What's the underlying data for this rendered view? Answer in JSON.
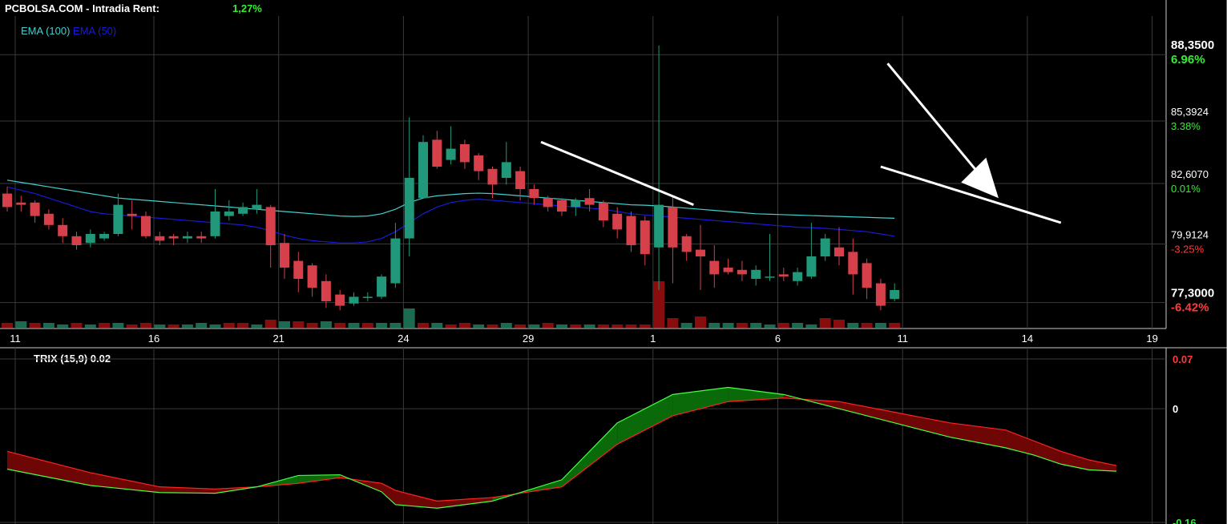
{
  "header": {
    "brand": "PCBOLSA.COM",
    "separator": "-",
    "mode": "Intradia",
    "rent_label": "Rent:",
    "rent_value": "1,27%"
  },
  "legend": [
    {
      "label": "EMA (100)",
      "color": "#3fd0d0"
    },
    {
      "label": "EMA (50)",
      "color": "#1a1ad8"
    }
  ],
  "colors": {
    "up": "#22987a",
    "down": "#d6404a",
    "vol_up": "#1a6b52",
    "vol_down": "#8a0d0d",
    "grid": "#3a3a3a",
    "positive_text": "#33ee33",
    "negative_text": "#ff3a3a",
    "trendline": "#ffffff"
  },
  "chart_data": [
    {
      "type": "candlestick",
      "title": "",
      "y_scale": {
        "min": 76.5,
        "max": 89.0
      },
      "price_labels": [
        {
          "price": "88,3500",
          "pct": "6.96%",
          "bold": true,
          "value": 88.35
        },
        {
          "price": "85,3924",
          "pct": "3.38%",
          "bold": false,
          "value": 85.3924
        },
        {
          "price": "82,6070",
          "pct": "0.01%",
          "bold": false,
          "value": 82.607
        },
        {
          "price": "79,9124",
          "pct": "-3.25%",
          "bold": false,
          "value": 79.9124
        },
        {
          "price": "77,3000",
          "pct": "-6.42%",
          "bold": true,
          "value": 77.3
        }
      ],
      "x_tick_labels": [
        {
          "label": "11",
          "index": 0
        },
        {
          "label": "16",
          "index": 10
        },
        {
          "label": "21",
          "index": 19
        },
        {
          "label": "24",
          "index": 28
        },
        {
          "label": "29",
          "index": 37
        },
        {
          "label": "1",
          "index": 46
        },
        {
          "label": "6",
          "index": 55
        },
        {
          "label": "11",
          "index": 64
        },
        {
          "label": "14",
          "index": 73
        },
        {
          "label": "19",
          "index": 82
        }
      ],
      "candles": [
        [
          81.8,
          81.2,
          82.1,
          81.0
        ],
        [
          81.4,
          81.3,
          81.7,
          81.0
        ],
        [
          81.4,
          80.8,
          81.5,
          80.5
        ],
        [
          80.9,
          80.4,
          81.1,
          80.2
        ],
        [
          80.4,
          79.9,
          80.7,
          79.6
        ],
        [
          79.9,
          79.5,
          80.1,
          79.3
        ],
        [
          79.6,
          80.0,
          80.2,
          79.4
        ],
        [
          79.8,
          80.0,
          80.1,
          79.7
        ],
        [
          80.0,
          81.3,
          81.8,
          79.9
        ],
        [
          80.9,
          80.8,
          81.5,
          80.2
        ],
        [
          80.8,
          79.9,
          81.0,
          79.8
        ],
        [
          79.9,
          79.7,
          80.1,
          79.5
        ],
        [
          79.9,
          79.8,
          80.0,
          79.5
        ],
        [
          79.8,
          79.9,
          80.1,
          79.6
        ],
        [
          79.9,
          79.8,
          80.1,
          79.6
        ],
        [
          79.9,
          81.0,
          82.0,
          79.8
        ],
        [
          80.8,
          81.0,
          81.5,
          80.6
        ],
        [
          80.9,
          81.2,
          81.4,
          80.8
        ],
        [
          81.1,
          81.3,
          82.0,
          80.9
        ],
        [
          81.2,
          79.5,
          81.3,
          78.5
        ],
        [
          79.6,
          78.5,
          80.0,
          78.0
        ],
        [
          78.8,
          78.0,
          79.2,
          77.4
        ],
        [
          78.6,
          77.6,
          78.7,
          77.2
        ],
        [
          77.9,
          77.0,
          78.2,
          76.7
        ],
        [
          77.3,
          76.8,
          77.5,
          76.6
        ],
        [
          76.9,
          77.2,
          77.4,
          76.8
        ],
        [
          77.2,
          77.2,
          77.4,
          77.0
        ],
        [
          77.2,
          78.1,
          78.2,
          77.1
        ],
        [
          77.8,
          79.8,
          80.5,
          77.6
        ],
        [
          79.8,
          82.5,
          85.2,
          79.0
        ],
        [
          81.6,
          84.1,
          84.4,
          81.6
        ],
        [
          84.2,
          83.0,
          84.6,
          82.9
        ],
        [
          83.3,
          83.8,
          84.8,
          83.1
        ],
        [
          84.0,
          83.2,
          84.2,
          82.9
        ],
        [
          83.5,
          82.8,
          83.6,
          82.4
        ],
        [
          82.9,
          82.2,
          83.0,
          81.6
        ],
        [
          82.5,
          83.2,
          84.1,
          82.2
        ],
        [
          82.8,
          82.0,
          83.0,
          81.5
        ],
        [
          82.0,
          81.6,
          82.2,
          81.3
        ],
        [
          81.6,
          81.2,
          81.7,
          81.0
        ],
        [
          81.5,
          81.0,
          81.6,
          80.8
        ],
        [
          81.2,
          81.5,
          81.6,
          80.8
        ],
        [
          81.6,
          81.3,
          82.0,
          81.0
        ],
        [
          81.4,
          80.6,
          81.5,
          80.3
        ],
        [
          80.9,
          80.2,
          81.2,
          79.8
        ],
        [
          80.8,
          79.5,
          81.0,
          79.2
        ],
        [
          80.6,
          79.1,
          80.8,
          78.6
        ],
        [
          79.4,
          81.3,
          88.4,
          77.5
        ],
        [
          81.2,
          79.4,
          81.7,
          77.8
        ],
        [
          79.9,
          79.2,
          80.0,
          78.8
        ],
        [
          79.3,
          79.0,
          80.4,
          77.5
        ],
        [
          78.8,
          78.2,
          79.5,
          77.6
        ],
        [
          78.5,
          78.3,
          78.9,
          78.2
        ],
        [
          78.4,
          78.2,
          78.8,
          77.9
        ],
        [
          78.0,
          78.4,
          78.6,
          77.7
        ],
        [
          78.1,
          78.1,
          80.0,
          77.9
        ],
        [
          78.2,
          78.1,
          78.5,
          77.9
        ],
        [
          77.9,
          78.3,
          78.5,
          77.7
        ],
        [
          78.1,
          79.0,
          80.5,
          78.0
        ],
        [
          79.0,
          79.8,
          80.0,
          78.8
        ],
        [
          79.4,
          79.0,
          80.3,
          78.6
        ],
        [
          79.2,
          78.2,
          79.8,
          77.3
        ],
        [
          78.7,
          77.6,
          78.9,
          77.1
        ],
        [
          77.8,
          76.8,
          78.0,
          76.6
        ],
        [
          77.1,
          77.5,
          77.8,
          77.0
        ]
      ],
      "note": "candles are [open, close, high, low] in price units",
      "ema100": [
        82.4,
        82.3,
        82.2,
        82.1,
        82.0,
        81.9,
        81.8,
        81.7,
        81.6,
        81.55,
        81.5,
        81.45,
        81.4,
        81.35,
        81.3,
        81.25,
        81.2,
        81.15,
        81.1,
        81.05,
        81.0,
        80.95,
        80.9,
        80.85,
        80.8,
        80.78,
        80.8,
        80.9,
        81.1,
        81.4,
        81.6,
        81.7,
        81.75,
        81.8,
        81.82,
        81.8,
        81.75,
        81.7,
        81.65,
        81.6,
        81.55,
        81.5,
        81.45,
        81.4,
        81.35,
        81.3,
        81.28,
        81.25,
        81.2,
        81.15,
        81.1,
        81.05,
        81.0,
        80.95,
        80.9,
        80.88,
        80.86,
        80.84,
        80.82,
        80.8,
        80.78,
        80.76,
        80.74,
        80.72,
        80.7
      ],
      "ema50": [
        82.1,
        81.95,
        81.8,
        81.6,
        81.4,
        81.2,
        81.0,
        80.9,
        80.85,
        80.8,
        80.75,
        80.7,
        80.65,
        80.6,
        80.55,
        80.5,
        80.45,
        80.4,
        80.3,
        80.15,
        79.95,
        79.8,
        79.7,
        79.65,
        79.6,
        79.6,
        79.65,
        79.8,
        80.1,
        80.5,
        80.9,
        81.2,
        81.4,
        81.5,
        81.55,
        81.5,
        81.45,
        81.4,
        81.35,
        81.3,
        81.25,
        81.2,
        81.15,
        81.1,
        81.0,
        80.9,
        80.85,
        80.8,
        80.75,
        80.7,
        80.65,
        80.6,
        80.55,
        80.5,
        80.45,
        80.4,
        80.35,
        80.3,
        80.28,
        80.25,
        80.2,
        80.15,
        80.1,
        80.0,
        79.9
      ]
    },
    {
      "type": "area",
      "title": "TRIX (15,9) 0.02",
      "y_scale": {
        "min": -0.16,
        "max": 0.07
      },
      "y_tick_labels": [
        {
          "label": "0.07",
          "value": 0.07,
          "color": "#ff3a3a"
        },
        {
          "label": "0",
          "value": 0,
          "color": "#ffffff"
        },
        {
          "label": "-0.16",
          "value": -0.16,
          "color": "#33ee33"
        }
      ],
      "series": [
        {
          "name": "TRIX",
          "color": "#44ff44",
          "x": [
            0,
            6,
            11,
            15,
            18,
            21,
            24,
            27,
            28,
            31,
            35,
            40,
            44,
            48,
            52,
            56,
            60,
            64,
            68,
            72,
            74,
            76,
            78,
            80
          ],
          "values": [
            -0.085,
            -0.108,
            -0.118,
            -0.119,
            -0.11,
            -0.094,
            -0.093,
            -0.117,
            -0.135,
            -0.14,
            -0.13,
            -0.1,
            -0.02,
            0.02,
            0.03,
            0.02,
            0.0,
            -0.02,
            -0.04,
            -0.055,
            -0.065,
            -0.078,
            -0.086,
            -0.088
          ]
        },
        {
          "name": "Signal",
          "color": "#ff2222",
          "x": [
            0,
            6,
            11,
            15,
            18,
            21,
            24,
            27,
            28,
            31,
            35,
            40,
            44,
            48,
            52,
            56,
            60,
            64,
            68,
            72,
            74,
            76,
            78,
            80
          ],
          "values": [
            -0.06,
            -0.09,
            -0.11,
            -0.113,
            -0.11,
            -0.105,
            -0.097,
            -0.105,
            -0.115,
            -0.13,
            -0.125,
            -0.11,
            -0.05,
            -0.01,
            0.01,
            0.015,
            0.01,
            -0.005,
            -0.02,
            -0.03,
            -0.045,
            -0.06,
            -0.072,
            -0.08
          ]
        }
      ],
      "xlabel": "",
      "ylabel": ""
    }
  ],
  "volume": [
    [
      "d",
      3
    ],
    [
      "u",
      4
    ],
    [
      "d",
      3
    ],
    [
      "u",
      3
    ],
    [
      "u",
      2
    ],
    [
      "d",
      3
    ],
    [
      "u",
      2
    ],
    [
      "d",
      3
    ],
    [
      "u",
      3
    ],
    [
      "d",
      2
    ],
    [
      "d",
      3
    ],
    [
      "u",
      2
    ],
    [
      "d",
      2
    ],
    [
      "u",
      2
    ],
    [
      "u",
      3
    ],
    [
      "u",
      2
    ],
    [
      "d",
      3
    ],
    [
      "d",
      3
    ],
    [
      "u",
      2
    ],
    [
      "d",
      5
    ],
    [
      "u",
      4
    ],
    [
      "d",
      4
    ],
    [
      "d",
      3
    ],
    [
      "u",
      4
    ],
    [
      "d",
      3
    ],
    [
      "u",
      3
    ],
    [
      "d",
      3
    ],
    [
      "u",
      3
    ],
    [
      "u",
      3
    ],
    [
      "u",
      12
    ],
    [
      "d",
      3
    ],
    [
      "u",
      3
    ],
    [
      "d",
      2
    ],
    [
      "d",
      3
    ],
    [
      "u",
      2
    ],
    [
      "d",
      2
    ],
    [
      "u",
      3
    ],
    [
      "d",
      2
    ],
    [
      "u",
      2
    ],
    [
      "d",
      3
    ],
    [
      "u",
      2
    ],
    [
      "d",
      2
    ],
    [
      "u",
      2
    ],
    [
      "d",
      2
    ],
    [
      "d",
      2
    ],
    [
      "d",
      2
    ],
    [
      "d",
      2
    ],
    [
      "d",
      29
    ],
    [
      "d",
      6
    ],
    [
      "u",
      3
    ],
    [
      "d",
      7
    ],
    [
      "u",
      3
    ],
    [
      "u",
      3
    ],
    [
      "d",
      3
    ],
    [
      "u",
      3
    ],
    [
      "u",
      2
    ],
    [
      "d",
      3
    ],
    [
      "u",
      3
    ],
    [
      "u",
      2
    ],
    [
      "d",
      6
    ],
    [
      "d",
      5
    ],
    [
      "u",
      3
    ],
    [
      "d",
      3
    ],
    [
      "u",
      3
    ],
    [
      "d",
      3
    ]
  ]
}
